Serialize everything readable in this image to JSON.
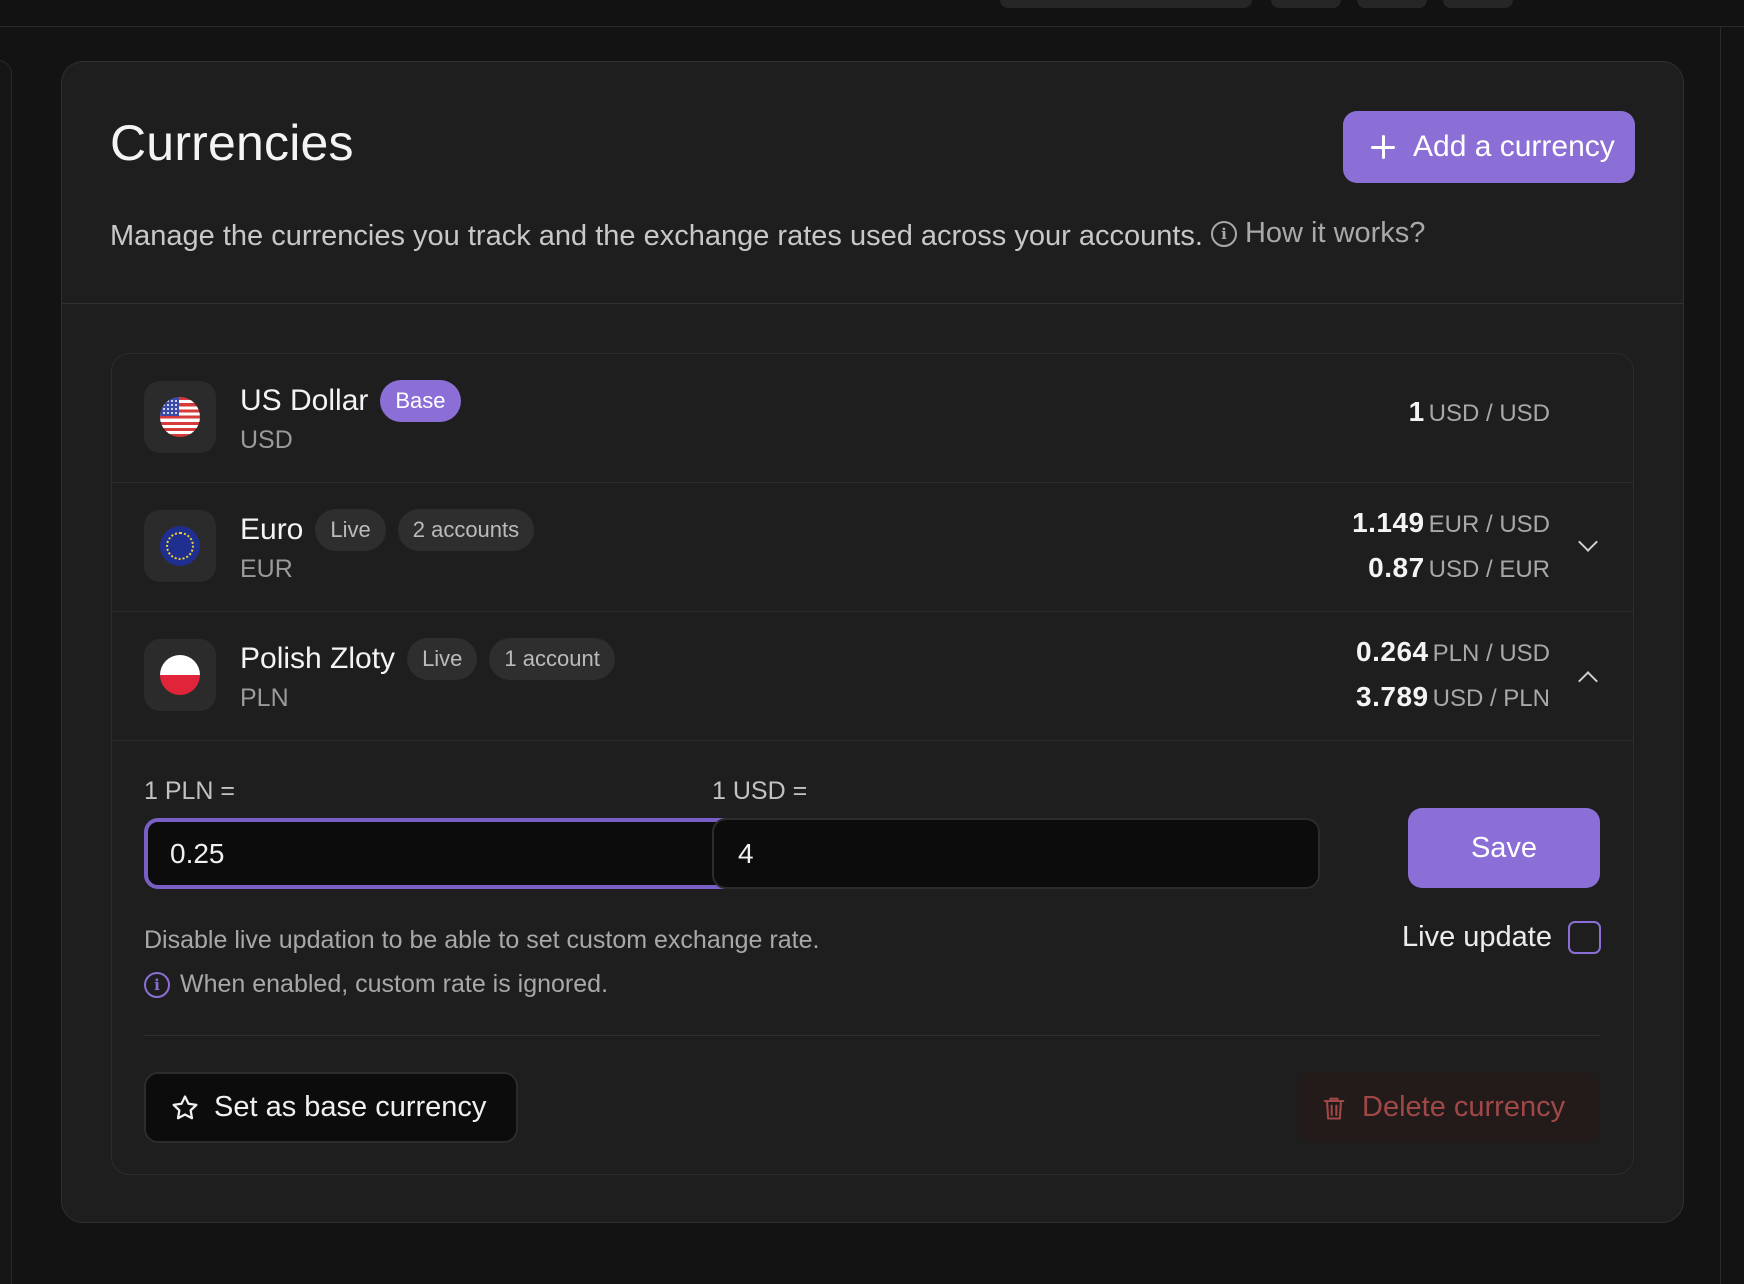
{
  "page": {
    "title": "Currencies",
    "add_button": "Add a currency",
    "subtitle": "Manage the currencies you track and the exchange rates used across your accounts.",
    "how_it_works": "How it works?"
  },
  "currencies": [
    {
      "name": "US Dollar",
      "code": "USD",
      "badges": [
        "Base"
      ],
      "rates": [
        {
          "value": "1",
          "unit": "USD / USD"
        }
      ]
    },
    {
      "name": "Euro",
      "code": "EUR",
      "badges": [
        "Live",
        "2 accounts"
      ],
      "rates": [
        {
          "value": "1.149",
          "unit": "EUR / USD"
        },
        {
          "value": "0.87",
          "unit": "USD / EUR"
        }
      ],
      "expanded": false
    },
    {
      "name": "Polish Zloty",
      "code": "PLN",
      "badges": [
        "Live",
        "1 account"
      ],
      "rates": [
        {
          "value": "0.264",
          "unit": "PLN / USD"
        },
        {
          "value": "3.789",
          "unit": "USD / PLN"
        }
      ],
      "expanded": true
    }
  ],
  "editor": {
    "field1_label": "1 PLN =",
    "field1_value": "0.25",
    "field2_label": "1 USD =",
    "field2_value": "4",
    "save_label": "Save",
    "hint": "Disable live updation to be able to set custom exchange rate.",
    "hint_note": "When enabled, custom rate is ignored.",
    "live_update_label": "Live update",
    "live_update_checked": false,
    "set_base_label": "Set as base currency",
    "delete_label": "Delete currency"
  },
  "colors": {
    "accent": "#8b6fd6",
    "danger": "#a04848",
    "background": "#1e1e1e"
  }
}
